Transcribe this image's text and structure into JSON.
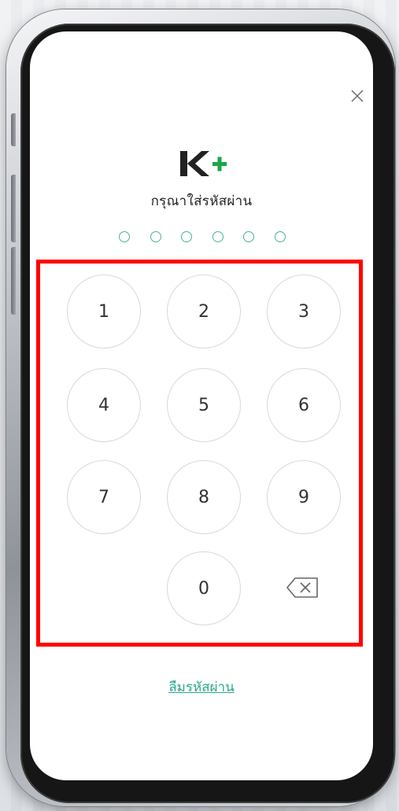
{
  "prompt": "กรุณาใส่รหัสผ่าน",
  "pin_length": 6,
  "keypad": {
    "keys": [
      "1",
      "2",
      "3",
      "4",
      "5",
      "6",
      "7",
      "8",
      "9",
      "0"
    ],
    "backspace_icon": "backspace-icon"
  },
  "forgot_link": "ลืมรหัสผ่าน",
  "icons": {
    "close": "close-icon",
    "logo": "kplus-logo"
  },
  "colors": {
    "accent": "#2aa88f",
    "logo_dark": "#222222",
    "logo_plus": "#19a74a",
    "highlight": "#ff0000"
  }
}
